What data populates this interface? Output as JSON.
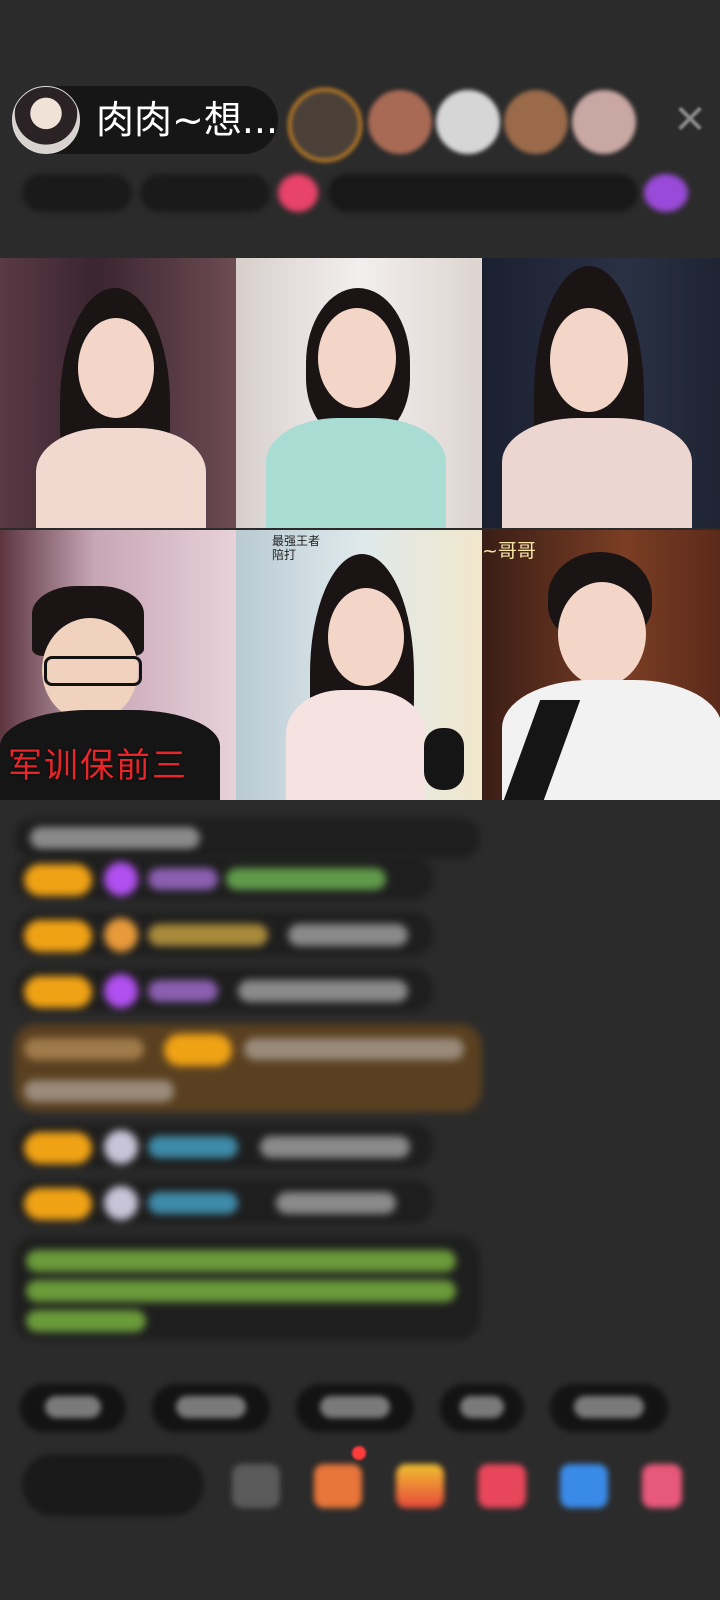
{
  "header": {
    "host_name": "肉肉~想...",
    "close_icon": "close-icon"
  },
  "viewers": [
    {
      "color": "#c97a2c"
    },
    {
      "color": "#a86a55"
    },
    {
      "color": "#cfcfcf"
    },
    {
      "color": "#9a6a4a"
    },
    {
      "color": "#c9a7a2"
    }
  ],
  "video_grid": {
    "tiles": [
      {
        "bg": "#4a3238",
        "badge": "",
        "caption": ""
      },
      {
        "bg": "#e9e2de",
        "badge": "",
        "caption": ""
      },
      {
        "bg": "#1d2433",
        "badge": "",
        "caption": ""
      },
      {
        "bg": "#6b4e5a",
        "badge": "",
        "caption": "军训保前三"
      },
      {
        "bg": "#c7d7de",
        "badge": "最强王者 陪打",
        "caption": ""
      },
      {
        "bg": "#5a3326",
        "badge": "~哥哥",
        "caption": ""
      }
    ]
  },
  "colors": {
    "background": "#2b2b2b",
    "level_badge": "#f0a215",
    "accent_red": "#e8262a"
  }
}
